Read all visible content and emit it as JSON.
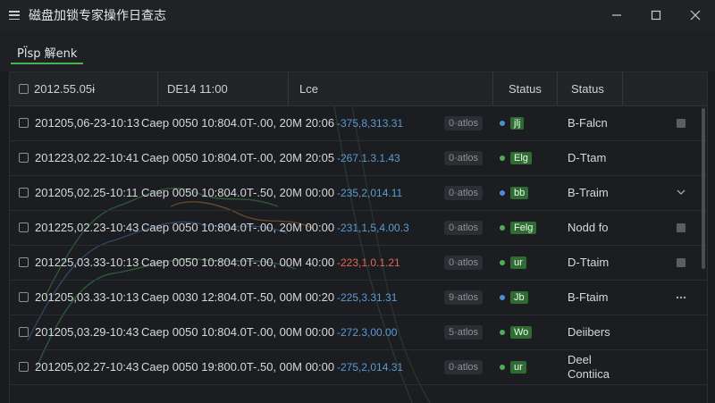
{
  "window": {
    "title": "磁盘加锁专家操作日查志"
  },
  "toolbar": {
    "tab_label": "Pl̈sp 解enk"
  },
  "table": {
    "headers": {
      "col1": "2012.55.05ɨ",
      "col2": "DE14 11:00",
      "col3": "Lce",
      "col4": "Status",
      "col5": "Status"
    },
    "rows": [
      {
        "date": "201205,06-23-10:13",
        "code": "Caep 0050 10:804.0T-.00, 20M 20:06",
        "value": "-375,8,313.31",
        "ratio": "0·atlos",
        "tag": "jlj",
        "text": "B-Falcn",
        "action": "square"
      },
      {
        "date": "201223,02.22-10:41",
        "code": "Caep 0050 10:804.0T-.00, 20M 20:05",
        "value": "-267.1.3.1.43",
        "ratio": "0·atlos",
        "tag": "Elg",
        "text": "D-Ttam",
        "action": "none"
      },
      {
        "date": "201205,02.25-10:11",
        "code": "Caep 0050 10:804.0T-.50, 20M 00:00",
        "value": "-235,2,014.11",
        "ratio": "0·atlos",
        "tag": "bb",
        "text": "B-Traim",
        "action": "chevron"
      },
      {
        "date": "201225,02.23-10:43",
        "code": "Caep 0050 10:804.0T-.00, 20M 00:00",
        "value": "-231,1,5,4.00.3",
        "ratio": "0·atlos",
        "tag": "Felg",
        "text": "Nodd fo",
        "action": "square"
      },
      {
        "date": "201225,03.33-10:13",
        "code": "Caep 0050 10:804.0T-.00, 00M 40:00",
        "value": "-223,1.0.1.21",
        "ratio": "0·atlos",
        "tag": "ur",
        "text": "D-Ttaim",
        "action": "square"
      },
      {
        "date": "201205,03.33-10:13",
        "code": "Caep 0030 12:804.0T-.50, 00M 00:20",
        "value": "-225,3.31.31",
        "ratio": "9·atlos",
        "tag": "Jb",
        "text": "B-Ftaim",
        "action": "more"
      },
      {
        "date": "201205,03.29-10:43",
        "code": "Caep 0050 10:804.0T-.00, 00M 00:00",
        "value": "-272.3,00.00",
        "ratio": "5·atlos",
        "tag": "Wo",
        "text": "Deiibers",
        "action": "none"
      },
      {
        "date": "201205,02.27-10:43",
        "code": "Caep 0050 19:800.0T-.50, 00M 00:00",
        "value": "-275,2,014.31",
        "ratio": "0·atlos",
        "tag": "ur",
        "text": "Deel\nContiica",
        "action": "none"
      }
    ]
  },
  "colors": {
    "accent": "#4caf50",
    "value_blue": "#5b9bd5",
    "value_red": "#e0684f",
    "dot_blue": "#4a90d9",
    "dot_green": "#4caf50"
  }
}
